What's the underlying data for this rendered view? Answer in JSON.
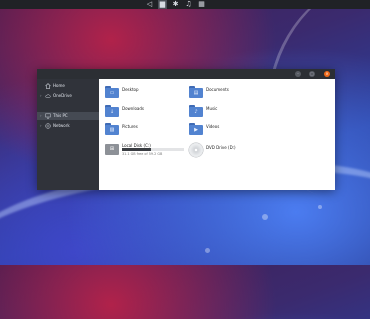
{
  "taskbar": {
    "icons": [
      {
        "name": "back-icon",
        "glyph": "◁",
        "active": false
      },
      {
        "name": "folder-icon",
        "glyph": "▆",
        "active": true
      },
      {
        "name": "gear-icon",
        "glyph": "✱",
        "active": false
      },
      {
        "name": "music-icon",
        "glyph": "♫",
        "active": false
      },
      {
        "name": "calculator-icon",
        "glyph": "▦",
        "active": false
      }
    ]
  },
  "window": {
    "sidebar": {
      "items": [
        {
          "label": "Home",
          "icon": "home-icon",
          "chevron": false,
          "selected": false
        },
        {
          "label": "OneDrive",
          "icon": "cloud-icon",
          "chevron": true,
          "selected": false
        },
        {
          "label": "This PC",
          "icon": "computer-icon",
          "chevron": true,
          "selected": true
        },
        {
          "label": "Network",
          "icon": "network-icon",
          "chevron": true,
          "selected": false
        }
      ]
    },
    "folders": [
      {
        "label": "Desktop",
        "icon": "desktop-folder-icon",
        "glyph": "▭"
      },
      {
        "label": "Documents",
        "icon": "documents-folder-icon",
        "glyph": "▤"
      },
      {
        "label": "Downloads",
        "icon": "downloads-folder-icon",
        "glyph": "↓"
      },
      {
        "label": "Music",
        "icon": "music-folder-icon",
        "glyph": "♪"
      },
      {
        "label": "Pictures",
        "icon": "pictures-folder-icon",
        "glyph": "▨"
      },
      {
        "label": "Videos",
        "icon": "videos-folder-icon",
        "glyph": "▶"
      }
    ],
    "drives": {
      "local_disk": {
        "label": "Local Disk (C:)",
        "sub": "31.1 GB free of 59.2 GB",
        "used_fraction": 0.47
      },
      "dvd_drive": {
        "label": "DVD Drive (D:)"
      }
    }
  },
  "colors": {
    "accent_close": "#f06a1a",
    "folder_blue": "#5283d0",
    "sidebar_bg": "#30333a"
  }
}
